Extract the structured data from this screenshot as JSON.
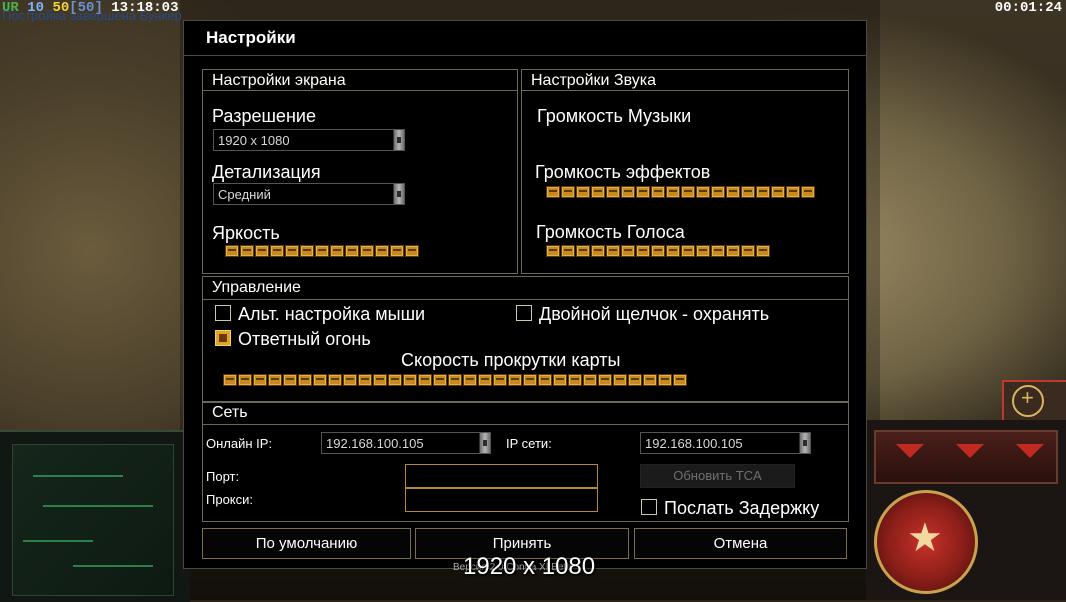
{
  "overlay": {
    "ur": "UR",
    "n1": "10",
    "n2": "50",
    "n3": "[50]",
    "clock": "13:18:03",
    "subtitle": "Постройка завершена Бункер",
    "timer": "00:01:24"
  },
  "dialog": {
    "title": "Настройки",
    "screen": {
      "header": "Настройки экрана",
      "resolution_label": "Разрешение",
      "resolution_value": "1920 x 1080",
      "detail_label": "Детализация",
      "detail_value": "Средний",
      "brightness_label": "Яркость",
      "brightness_level": 1.0
    },
    "sound": {
      "header": "Настройки Звука",
      "music_label": "Громкость Музыки",
      "effects_label": "Громкость эффектов",
      "effects_level": 1.0,
      "voice_label": "Громкость Голоса",
      "voice_level": 1.0
    },
    "controls": {
      "header": "Управление",
      "alt_mouse_label": "Альт. настройка мыши",
      "alt_mouse_checked": false,
      "double_click_label": "Двойной щелчок - охранять",
      "double_click_checked": false,
      "return_fire_label": "Ответный огонь",
      "return_fire_checked": true,
      "scroll_speed_label": "Скорость прокрутки карты",
      "scroll_speed_level": 1.0
    },
    "network": {
      "header": "Сеть",
      "online_ip_label": "Онлайн IP:",
      "online_ip_value": "192.168.100.105",
      "network_ip_label": "IP сети:",
      "network_ip_value": "192.168.100.105",
      "port_label": "Порт:",
      "port_value": "",
      "proxy_label": "Прокси:",
      "proxy_value": "",
      "update_tca_label": "Обновить TCA",
      "send_delay_label": "Послать Задержку",
      "send_delay_checked": false
    },
    "buttons": {
      "default_label": "По умолчанию",
      "accept_label": "Принять",
      "cancel_label": "Отмена"
    },
    "version_text": "Версия 2.0 Contra XI Beta",
    "tooltip_text": "1920 x 1080"
  },
  "colors": {
    "slider_fill": "#c88a1e",
    "field_border": "#b68a33",
    "checked_fill": "#e0a327"
  }
}
